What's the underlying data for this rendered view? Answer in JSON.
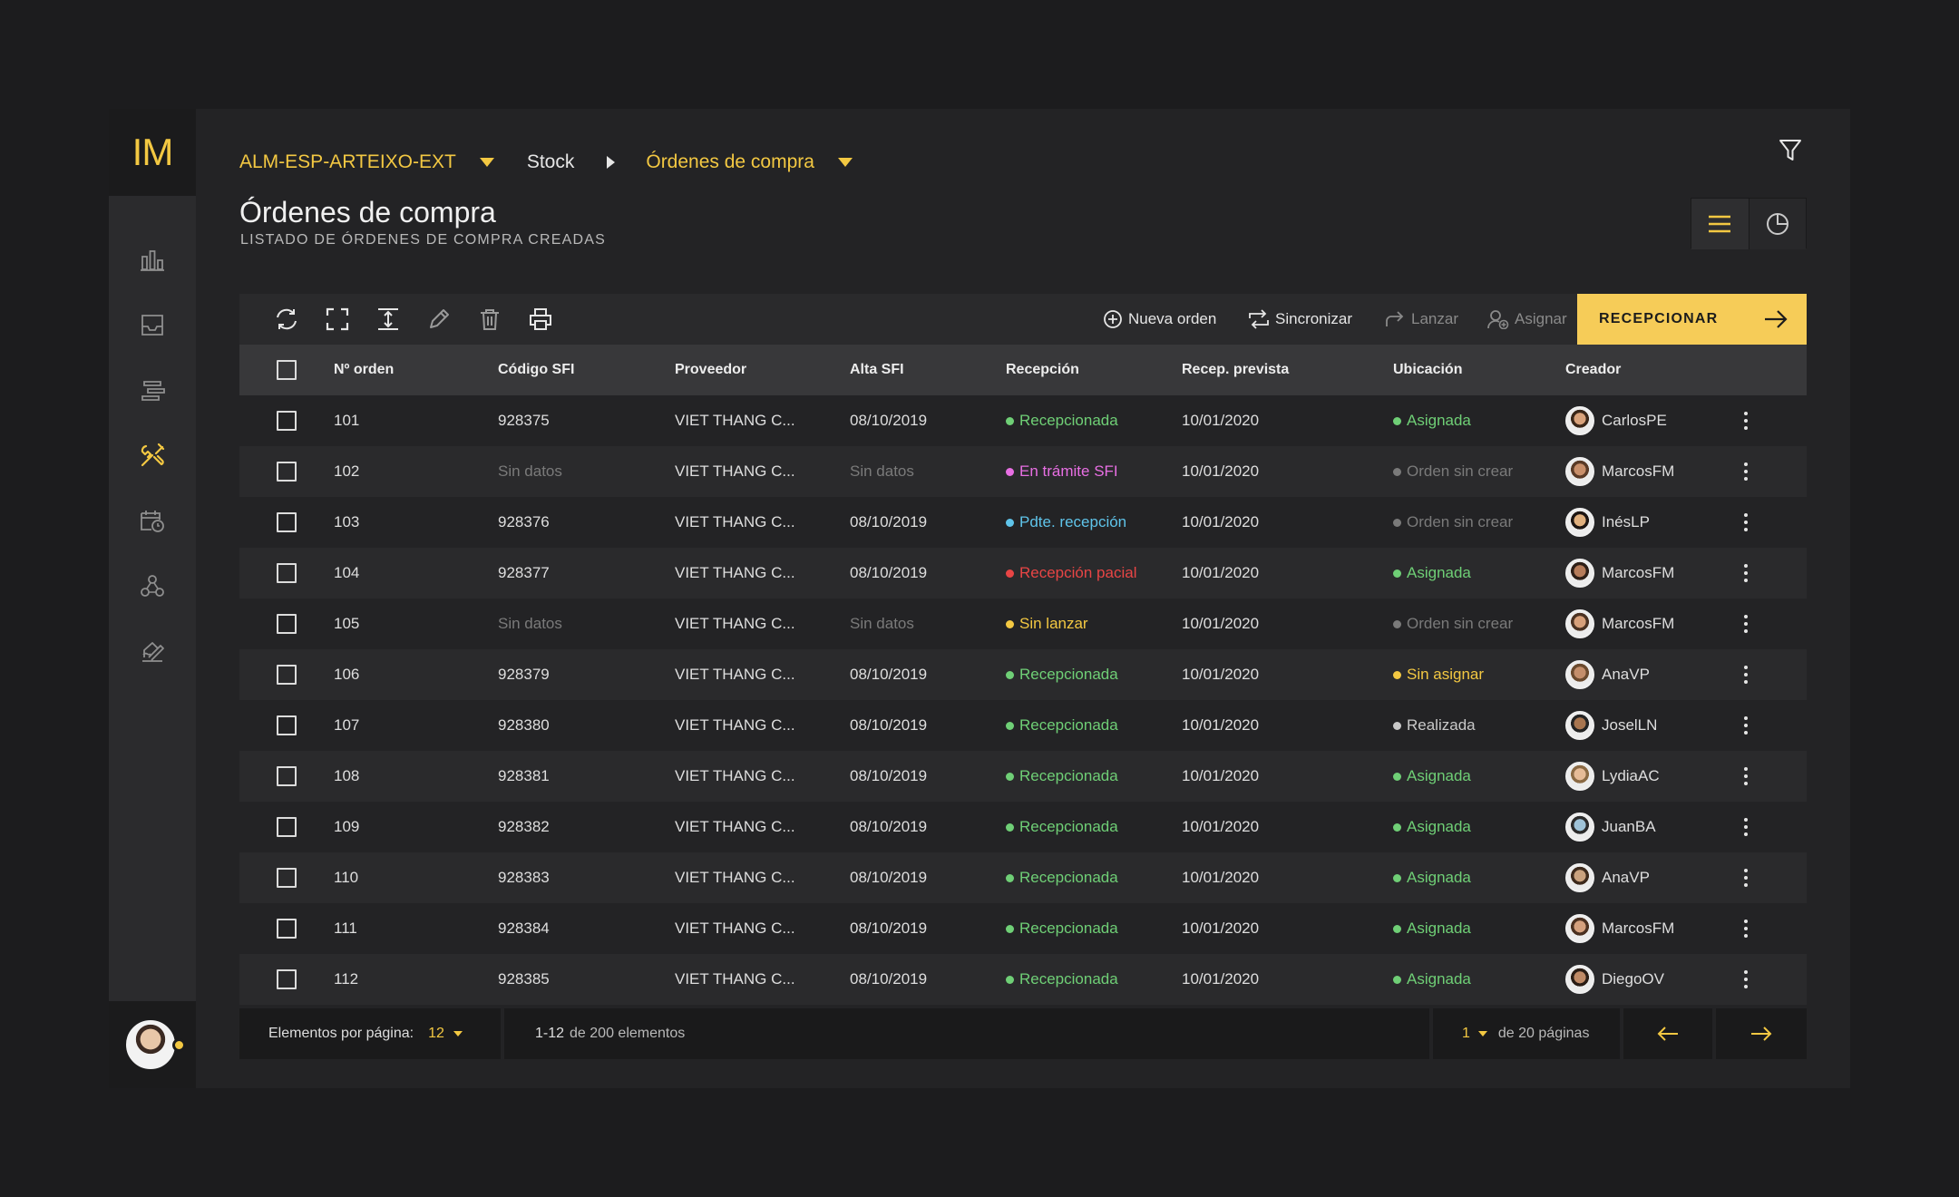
{
  "sidebar": {
    "logo": "IM",
    "icons": [
      "bar-chart-icon",
      "inbox-tray-icon",
      "stack-lines-icon",
      "tools-icon",
      "calendar-clock-icon",
      "network-nodes-icon",
      "signature-icon"
    ],
    "active_index": 3
  },
  "header": {
    "breadcrumb": [
      {
        "label": "ALM-ESP-ARTEIXO-EXT",
        "style": "accent",
        "separator": "chevron-down-icon"
      },
      {
        "label": "Stock",
        "style": "plain",
        "separator": "chevron-right-icon"
      },
      {
        "label": "Órdenes de compra",
        "style": "accent",
        "separator": "chevron-down-icon"
      }
    ],
    "title": "Órdenes de compra",
    "subtitle": "LISTADO DE ÓRDENES DE COMPRA CREADAS"
  },
  "toolbar": {
    "tools": [
      "refresh-icon",
      "expand-icon",
      "row-height-icon",
      "edit-icon",
      "delete-icon",
      "print-icon"
    ],
    "actions": [
      {
        "label": "Nueva orden",
        "icon": "plus-circle-icon",
        "enabled": true
      },
      {
        "label": "Sincronizar",
        "icon": "sync-icon",
        "enabled": true
      },
      {
        "label": "Lanzar",
        "icon": "forward-icon",
        "enabled": false
      },
      {
        "label": "Asignar",
        "icon": "user-add-icon",
        "enabled": false
      }
    ],
    "primary_label": "RECEPCIONAR"
  },
  "colors": {
    "accent": "#f3c842",
    "green": "#6fcf76",
    "magenta": "#e86fe3",
    "blue": "#5fc4ea",
    "red": "#e84545",
    "yellow": "#f3c842",
    "grey": "#7a7a7a",
    "light": "#c9c9c9"
  },
  "table": {
    "columns": [
      "Nº orden",
      "Código SFI",
      "Proveedor",
      "Alta SFI",
      "Recepción",
      "Recep. prevista",
      "Ubicación",
      "Creador"
    ],
    "rows": [
      {
        "orden": "101",
        "codigo": "928375",
        "proveedor": "VIET THANG C...",
        "alta": "08/10/2019",
        "recepcion": "Recepcionada",
        "rec_color": "green",
        "prevista": "10/01/2020",
        "ubicacion": "Asignada",
        "ubi_color": "green",
        "creador": "CarlosPE"
      },
      {
        "orden": "102",
        "codigo": "Sin datos",
        "proveedor": "VIET THANG C...",
        "alta": "Sin datos",
        "recepcion": "En trámite SFI",
        "rec_color": "magenta",
        "prevista": "10/01/2020",
        "ubicacion": "Orden sin crear",
        "ubi_color": "grey",
        "creador": "MarcosFM"
      },
      {
        "orden": "103",
        "codigo": "928376",
        "proveedor": "VIET THANG C...",
        "alta": "08/10/2019",
        "recepcion": "Pdte. recepción",
        "rec_color": "blue",
        "prevista": "10/01/2020",
        "ubicacion": "Orden sin crear",
        "ubi_color": "grey",
        "creador": "InésLP"
      },
      {
        "orden": "104",
        "codigo": "928377",
        "proveedor": "VIET THANG C...",
        "alta": "08/10/2019",
        "recepcion": "Recepción pacial",
        "rec_color": "red",
        "prevista": "10/01/2020",
        "ubicacion": "Asignada",
        "ubi_color": "green",
        "creador": "MarcosFM"
      },
      {
        "orden": "105",
        "codigo": "Sin datos",
        "proveedor": "VIET THANG C...",
        "alta": "Sin datos",
        "recepcion": "Sin lanzar",
        "rec_color": "yellow",
        "prevista": "10/01/2020",
        "ubicacion": "Orden sin crear",
        "ubi_color": "grey",
        "creador": "MarcosFM"
      },
      {
        "orden": "106",
        "codigo": "928379",
        "proveedor": "VIET THANG C...",
        "alta": "08/10/2019",
        "recepcion": "Recepcionada",
        "rec_color": "green",
        "prevista": "10/01/2020",
        "ubicacion": "Sin asignar",
        "ubi_color": "yellow",
        "creador": "AnaVP"
      },
      {
        "orden": "107",
        "codigo": "928380",
        "proveedor": "VIET THANG C...",
        "alta": "08/10/2019",
        "recepcion": "Recepcionada",
        "rec_color": "green",
        "prevista": "10/01/2020",
        "ubicacion": "Realizada",
        "ubi_color": "light",
        "creador": "JoselLN"
      },
      {
        "orden": "108",
        "codigo": "928381",
        "proveedor": "VIET THANG C...",
        "alta": "08/10/2019",
        "recepcion": "Recepcionada",
        "rec_color": "green",
        "prevista": "10/01/2020",
        "ubicacion": "Asignada",
        "ubi_color": "green",
        "creador": "LydiaAC"
      },
      {
        "orden": "109",
        "codigo": "928382",
        "proveedor": "VIET THANG C...",
        "alta": "08/10/2019",
        "recepcion": "Recepcionada",
        "rec_color": "green",
        "prevista": "10/01/2020",
        "ubicacion": "Asignada",
        "ubi_color": "green",
        "creador": "JuanBA"
      },
      {
        "orden": "110",
        "codigo": "928383",
        "proveedor": "VIET THANG C...",
        "alta": "08/10/2019",
        "recepcion": "Recepcionada",
        "rec_color": "green",
        "prevista": "10/01/2020",
        "ubicacion": "Asignada",
        "ubi_color": "green",
        "creador": "AnaVP"
      },
      {
        "orden": "111",
        "codigo": "928384",
        "proveedor": "VIET THANG C...",
        "alta": "08/10/2019",
        "recepcion": "Recepcionada",
        "rec_color": "green",
        "prevista": "10/01/2020",
        "ubicacion": "Asignada",
        "ubi_color": "green",
        "creador": "MarcosFM"
      },
      {
        "orden": "112",
        "codigo": "928385",
        "proveedor": "VIET THANG C...",
        "alta": "08/10/2019",
        "recepcion": "Recepcionada",
        "rec_color": "green",
        "prevista": "10/01/2020",
        "ubicacion": "Asignada",
        "ubi_color": "green",
        "creador": "DiegoOV"
      }
    ]
  },
  "footer": {
    "per_page_label": "Elementos por página:",
    "per_page_value": "12",
    "range": "1-12",
    "range_suffix": "de 200 elementos",
    "page_value": "1",
    "page_suffix": "de 20 páginas",
    "prev_icon": "arrow-left-icon",
    "next_icon": "arrow-right-icon"
  }
}
